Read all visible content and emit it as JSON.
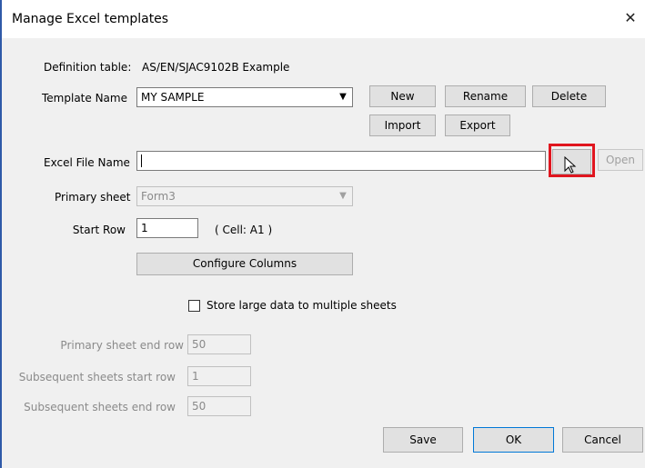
{
  "window": {
    "title": "Manage Excel templates",
    "close_glyph": "✕"
  },
  "definition": {
    "label": "Definition table:",
    "value": "AS/EN/SJAC9102B Example"
  },
  "template": {
    "label": "Template Name",
    "selected": "MY SAMPLE",
    "buttons": {
      "new": "New",
      "rename": "Rename",
      "delete": "Delete",
      "import": "Import",
      "export": "Export"
    }
  },
  "excel_file": {
    "label": "Excel File Name",
    "value": "",
    "browse_label": "",
    "open_label": "Open"
  },
  "primary_sheet": {
    "label": "Primary sheet",
    "selected": "Form3"
  },
  "start_row": {
    "label": "Start Row",
    "value": "1",
    "cell_text": "( Cell:  A1 )"
  },
  "configure_button": "Configure Columns",
  "store_large": {
    "label": "Store large data to multiple sheets",
    "checked": false
  },
  "primary_end_row": {
    "label": "Primary sheet end row",
    "value": "50"
  },
  "subsequent_start_row": {
    "label": "Subsequent sheets start row",
    "value": "1"
  },
  "subsequent_end_row": {
    "label": "Subsequent sheets end row",
    "value": "50"
  },
  "footer": {
    "save": "Save",
    "ok": "OK",
    "cancel": "Cancel"
  },
  "colors": {
    "highlight": "#e0161f",
    "left_border": "#2f5aa8"
  }
}
